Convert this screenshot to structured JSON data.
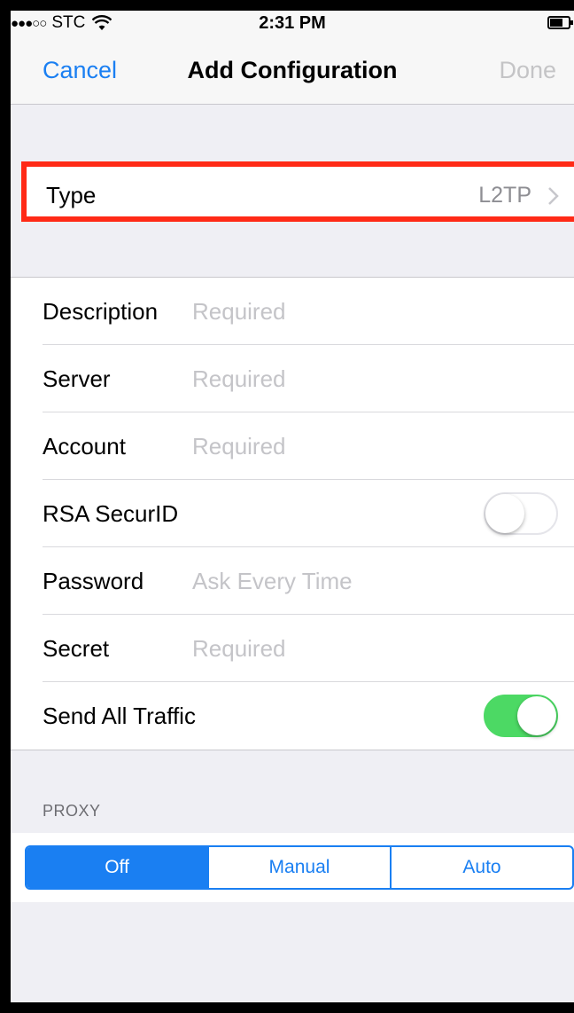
{
  "status_bar": {
    "signal": "●●●○○",
    "carrier": "STC",
    "time": "2:31 PM"
  },
  "nav": {
    "cancel_label": "Cancel",
    "title": "Add Configuration",
    "done_label": "Done"
  },
  "type_row": {
    "label": "Type",
    "value": "L2TP"
  },
  "form": {
    "description": {
      "label": "Description",
      "placeholder": "Required"
    },
    "server": {
      "label": "Server",
      "placeholder": "Required"
    },
    "account": {
      "label": "Account",
      "placeholder": "Required"
    },
    "rsa_securid": {
      "label": "RSA SecurID",
      "enabled": false
    },
    "password": {
      "label": "Password",
      "placeholder": "Ask Every Time"
    },
    "secret": {
      "label": "Secret",
      "placeholder": "Required"
    },
    "send_all_traffic": {
      "label": "Send All Traffic",
      "enabled": true
    }
  },
  "proxy": {
    "header": "PROXY",
    "options": [
      "Off",
      "Manual",
      "Auto"
    ],
    "selected": "Off"
  },
  "colors": {
    "accent": "#1a7ff2",
    "toggle_on": "#4cd964",
    "highlight": "#ff2a16"
  }
}
